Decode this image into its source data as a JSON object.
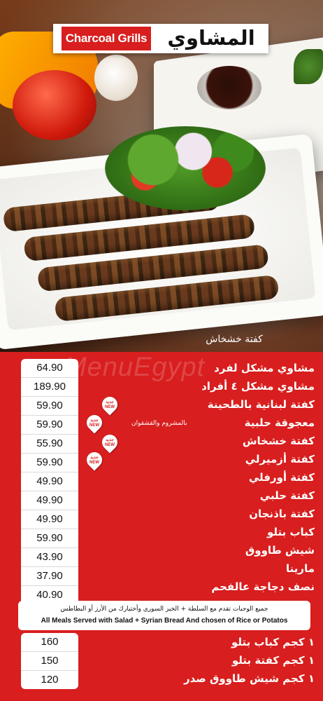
{
  "header": {
    "title_en": "Charcoal Grills",
    "title_ar": "المشاوي"
  },
  "photo_caption": "كفتة خشخاش",
  "watermark": "MenuEgypt",
  "menu_items": [
    {
      "name": "مشاوي مشكل لفرد",
      "price": "64.90",
      "is_new": false
    },
    {
      "name": "مشاوي مشكل ٤ أفراد",
      "price": "189.90",
      "is_new": false
    },
    {
      "name": "كفتة لبنانية بالطحينة",
      "price": "59.90",
      "is_new": true
    },
    {
      "name": "معجوقة حلبية",
      "note": "بالمشروم والقشقوان",
      "price": "59.90",
      "is_new": true
    },
    {
      "name": "كفتة خشخاش",
      "price": "55.90",
      "is_new": true
    },
    {
      "name": "كفتة أزميرلي",
      "price": "59.90",
      "is_new": true
    },
    {
      "name": "كفتة أورفلي",
      "price": "49.90",
      "is_new": false
    },
    {
      "name": "كفتة حلبي",
      "price": "49.90",
      "is_new": false
    },
    {
      "name": "كفتة باذنجان",
      "price": "49.90",
      "is_new": false
    },
    {
      "name": "كباب بتلو",
      "price": "59.90",
      "is_new": false
    },
    {
      "name": "شيش طاووق",
      "price": "43.90",
      "is_new": false
    },
    {
      "name": "مارينا",
      "price": "37.90",
      "is_new": false
    },
    {
      "name": "نصف دجاجة عالفحم",
      "price": "40.90",
      "is_new": false
    }
  ],
  "new_badge": {
    "ar": "جديد",
    "en": "NEW"
  },
  "meals_note": {
    "ar": "جميع الوجبات تقدم مع السلطة + الخبز السوري وأختيارك من الأرز أو البطاطس",
    "en": "All Meals Served with Salad + Syrian Bread And chosen of Rice or Potatos"
  },
  "kilo_items": [
    {
      "name": "١ كجم كباب بتلو",
      "price": "160"
    },
    {
      "name": "١ كجم كفتة بتلو",
      "price": "150"
    },
    {
      "name": "١ كجم شيش طاووق صدر",
      "price": "120"
    }
  ],
  "colors": {
    "brand_red": "#d81e1e",
    "white": "#ffffff"
  }
}
